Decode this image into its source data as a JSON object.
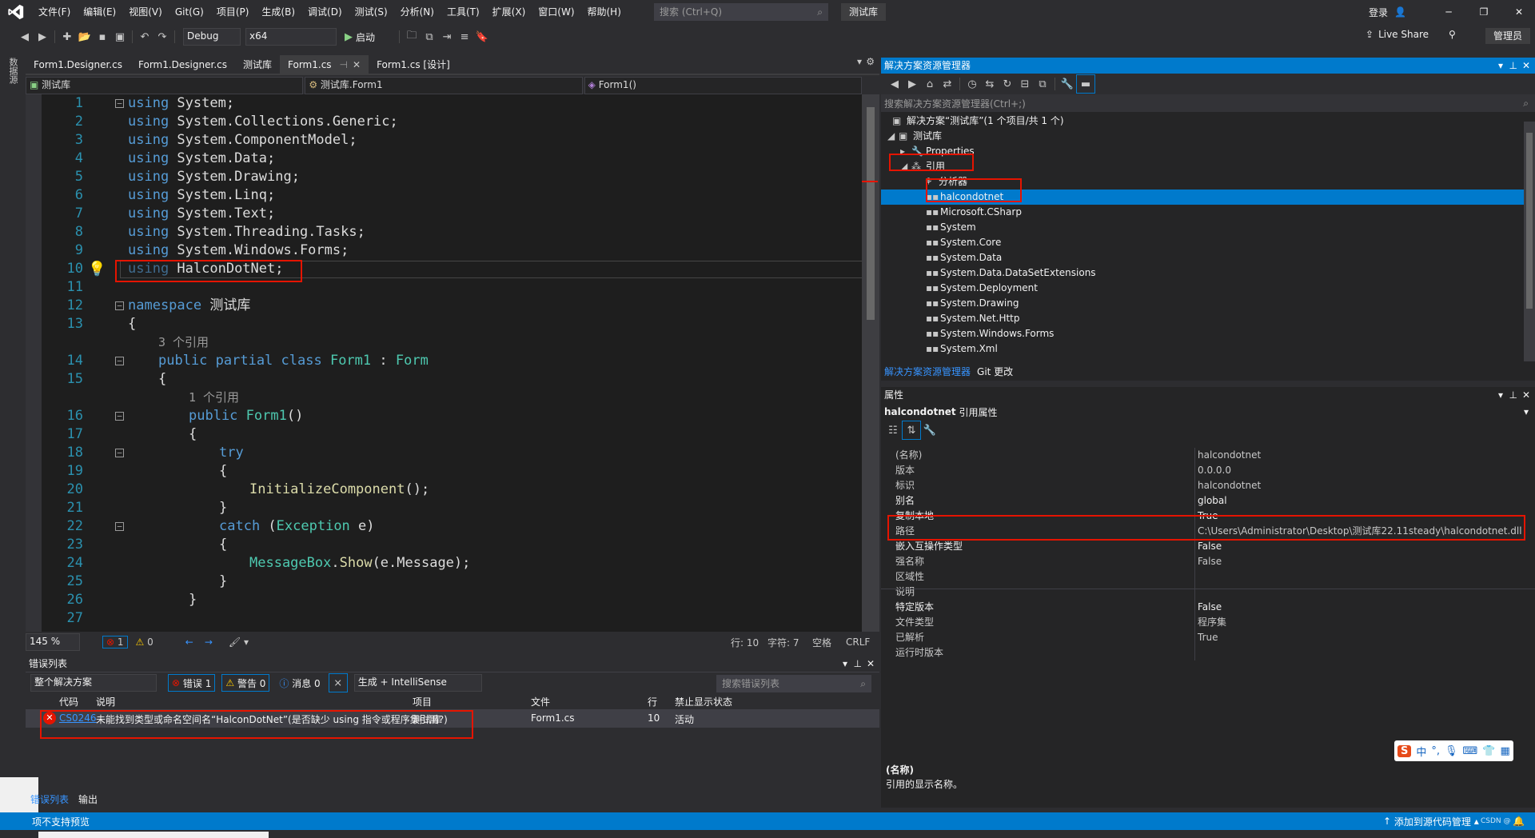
{
  "menubar": {
    "items": [
      "文件(F)",
      "编辑(E)",
      "视图(V)",
      "Git(G)",
      "项目(P)",
      "生成(B)",
      "调试(D)",
      "测试(S)",
      "分析(N)",
      "工具(T)",
      "扩展(X)",
      "窗口(W)",
      "帮助(H)"
    ],
    "search_placeholder": "搜索 (Ctrl+Q)",
    "solution_name": "测试库",
    "login": "登录"
  },
  "toolbar": {
    "config": "Debug",
    "platform": "x64",
    "start": "启动",
    "live_share": "Live Share",
    "admin": "管理员"
  },
  "side_strip": {
    "label": "数据源"
  },
  "editor": {
    "tabs": [
      {
        "label": "Form1.Designer.cs"
      },
      {
        "label": "Form1.Designer.cs"
      },
      {
        "label": "测试库"
      },
      {
        "label": "Form1.cs",
        "active": true
      },
      {
        "label": "Form1.cs [设计]"
      }
    ],
    "nav": {
      "project": "测试库",
      "class": "测试库.Form1",
      "member": "Form1()"
    },
    "lines": [
      {
        "n": "1",
        "indent": 0,
        "parts": [
          [
            "kw",
            "using"
          ],
          [
            "t",
            " System;"
          ]
        ],
        "fold": true
      },
      {
        "n": "2",
        "indent": 0,
        "parts": [
          [
            "kw",
            "using"
          ],
          [
            "t",
            " System.Collections.Generic;"
          ]
        ]
      },
      {
        "n": "3",
        "indent": 0,
        "parts": [
          [
            "kw",
            "using"
          ],
          [
            "t",
            " System.ComponentModel;"
          ]
        ]
      },
      {
        "n": "4",
        "indent": 0,
        "parts": [
          [
            "kw",
            "using"
          ],
          [
            "t",
            " System.Data;"
          ]
        ]
      },
      {
        "n": "5",
        "indent": 0,
        "parts": [
          [
            "kw",
            "using"
          ],
          [
            "t",
            " System.Drawing;"
          ]
        ]
      },
      {
        "n": "6",
        "indent": 0,
        "parts": [
          [
            "kw",
            "using"
          ],
          [
            "t",
            " System.Linq;"
          ]
        ]
      },
      {
        "n": "7",
        "indent": 0,
        "parts": [
          [
            "kw",
            "using"
          ],
          [
            "t",
            " System.Text;"
          ]
        ]
      },
      {
        "n": "8",
        "indent": 0,
        "parts": [
          [
            "kw",
            "using"
          ],
          [
            "t",
            " System.Threading.Tasks;"
          ]
        ]
      },
      {
        "n": "9",
        "indent": 0,
        "parts": [
          [
            "kw",
            "using"
          ],
          [
            "t",
            " System.Windows.Forms;"
          ]
        ]
      },
      {
        "n": "10",
        "indent": 0,
        "parts": [
          [
            "dk",
            "using"
          ],
          [
            "t",
            " HalconDotNet;"
          ]
        ]
      },
      {
        "n": "11",
        "indent": 0,
        "parts": []
      },
      {
        "n": "12",
        "indent": 0,
        "parts": [
          [
            "kw",
            "namespace"
          ],
          [
            "t",
            " 测试库"
          ]
        ],
        "fold": true
      },
      {
        "n": "13",
        "indent": 0,
        "parts": [
          [
            "t",
            "{"
          ]
        ]
      },
      {
        "n": "",
        "indent": 1,
        "parts": [
          [
            "cl",
            "3 个引用"
          ]
        ]
      },
      {
        "n": "14",
        "indent": 1,
        "parts": [
          [
            "kw",
            "public partial class"
          ],
          [
            "t",
            " "
          ],
          [
            "ty",
            "Form1"
          ],
          [
            "t",
            " : "
          ],
          [
            "ty",
            "Form"
          ]
        ],
        "fold": true
      },
      {
        "n": "15",
        "indent": 1,
        "parts": [
          [
            "t",
            "{"
          ]
        ]
      },
      {
        "n": "",
        "indent": 2,
        "parts": [
          [
            "cl",
            "1 个引用"
          ]
        ]
      },
      {
        "n": "16",
        "indent": 2,
        "parts": [
          [
            "kw",
            "public"
          ],
          [
            "t",
            " "
          ],
          [
            "ty",
            "Form1"
          ],
          [
            "t",
            "()"
          ]
        ],
        "fold": true
      },
      {
        "n": "17",
        "indent": 2,
        "parts": [
          [
            "t",
            "{"
          ]
        ]
      },
      {
        "n": "18",
        "indent": 3,
        "parts": [
          [
            "kw",
            "try"
          ]
        ],
        "fold": true
      },
      {
        "n": "19",
        "indent": 3,
        "parts": [
          [
            "t",
            "{"
          ]
        ]
      },
      {
        "n": "20",
        "indent": 4,
        "parts": [
          [
            "fn",
            "InitializeComponent"
          ],
          [
            "t",
            "();"
          ]
        ]
      },
      {
        "n": "21",
        "indent": 3,
        "parts": [
          [
            "t",
            "}"
          ]
        ]
      },
      {
        "n": "22",
        "indent": 3,
        "parts": [
          [
            "kw",
            "catch"
          ],
          [
            "t",
            " ("
          ],
          [
            "ty",
            "Exception"
          ],
          [
            "t",
            " e)"
          ]
        ],
        "fold": true
      },
      {
        "n": "23",
        "indent": 3,
        "parts": [
          [
            "t",
            "{"
          ]
        ]
      },
      {
        "n": "24",
        "indent": 4,
        "parts": [
          [
            "ty",
            "MessageBox"
          ],
          [
            "t",
            "."
          ],
          [
            "fn",
            "Show"
          ],
          [
            "t",
            "(e.Message);"
          ]
        ]
      },
      {
        "n": "25",
        "indent": 3,
        "parts": [
          [
            "t",
            "}"
          ]
        ]
      },
      {
        "n": "26",
        "indent": 2,
        "parts": [
          [
            "t",
            "}"
          ]
        ]
      },
      {
        "n": "27",
        "indent": 0,
        "parts": []
      }
    ],
    "partial_line": "1 个引用",
    "status": {
      "zoom": "145 %",
      "errors": "1",
      "warnings": "0",
      "line": "行: 10",
      "col": "字符: 7",
      "ws": "空格",
      "eol": "CRLF"
    }
  },
  "error_list": {
    "title": "错误列表",
    "scope": "整个解决方案",
    "errors_btn": "错误 1",
    "warnings_btn": "警告 0",
    "messages_btn": "消息 0",
    "build_filter": "生成 + IntelliSense",
    "search_placeholder": "搜索错误列表",
    "columns": [
      "代码",
      "说明",
      "项目",
      "文件",
      "行",
      "禁止显示状态"
    ],
    "rows": [
      {
        "code": "CS0246",
        "desc": "未能找到类型或命名空间名“HalconDotNet”(是否缺少 using 指令或程序集引用?)",
        "project": "测试库",
        "file": "Form1.cs",
        "line": "10",
        "state": "活动"
      }
    ],
    "tabs": [
      "错误列表",
      "输出"
    ]
  },
  "solution_explorer": {
    "title": "解决方案资源管理器",
    "search_placeholder": "搜索解决方案资源管理器(Ctrl+;)",
    "solution": "解决方案“测试库”(1 个项目/共 1 个)",
    "project": "测试库",
    "properties": "Properties",
    "references": "引用",
    "analyzers": "分析器",
    "refs": [
      "halcondotnet",
      "Microsoft.CSharp",
      "System",
      "System.Core",
      "System.Data",
      "System.Data.DataSetExtensions",
      "System.Deployment",
      "System.Drawing",
      "System.Net.Http",
      "System.Windows.Forms",
      "System.Xml"
    ],
    "bottom_tabs": [
      "解决方案资源管理器",
      "Git 更改"
    ]
  },
  "properties": {
    "title": "属性",
    "object_name": "halcondotnet",
    "object_type": "引用属性",
    "rows": [
      {
        "name": "(名称)",
        "value": "halcondotnet",
        "edit": false
      },
      {
        "name": "版本",
        "value": "0.0.0.0",
        "edit": false
      },
      {
        "name": "标识",
        "value": "halcondotnet",
        "edit": false
      },
      {
        "name": "别名",
        "value": "global",
        "edit": true
      },
      {
        "name": "复制本地",
        "value": "True",
        "edit": true
      },
      {
        "name": "路径",
        "value": "C:\\Users\\Administrator\\Desktop\\测试库22.11steady\\halcondotnet.dll",
        "edit": false
      },
      {
        "name": "嵌入互操作类型",
        "value": "False",
        "edit": true
      },
      {
        "name": "强名称",
        "value": "False",
        "edit": false
      },
      {
        "name": "区域性",
        "value": "",
        "edit": false
      },
      {
        "name": "说明",
        "value": "",
        "edit": false
      },
      {
        "name": "特定版本",
        "value": "False",
        "edit": true
      },
      {
        "name": "文件类型",
        "value": "程序集",
        "edit": false
      },
      {
        "name": "已解析",
        "value": "True",
        "edit": false
      },
      {
        "name": "运行时版本",
        "value": "",
        "edit": false
      }
    ],
    "desc_title": "(名称)",
    "desc_text": "引用的显示名称。"
  },
  "statusbar": {
    "left": "项不支持预览",
    "right": "添加到源代码管理",
    "ime": "中",
    "watermark": "CSDN @"
  },
  "colors": {
    "accent": "#007acc",
    "error": "#e51400",
    "selection": "#007acc"
  }
}
